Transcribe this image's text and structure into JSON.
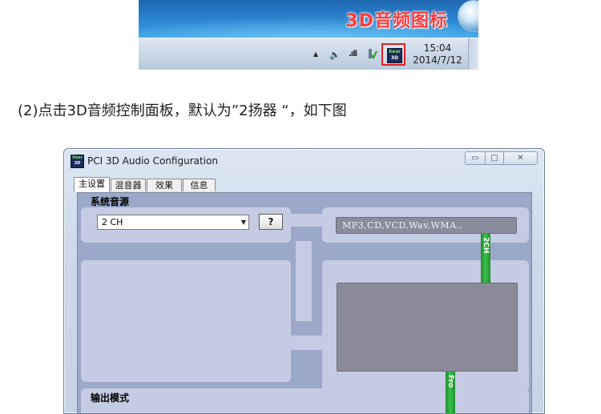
{
  "taskbar": {
    "annotation": "3D音频图标",
    "tray_icon_label_top": "Xear",
    "tray_icon_label_bottom": "3D",
    "time": "15:04",
    "date": "2014/7/12",
    "colors": {
      "annotation": "#ff3a3a",
      "highlight_border": "#e0201c"
    }
  },
  "instruction": "(2)点击3D音频控制面板，默认为”2扬器 “，如下图",
  "window": {
    "title": "PCI 3D Audio Configuration",
    "icon_label_top": "Xear",
    "icon_label_bottom": "3D",
    "controls": {
      "minimize": "▭",
      "maximize": "□",
      "close": "✕"
    },
    "tabs": [
      {
        "label": "主设置",
        "active": true
      },
      {
        "label": "混音器",
        "active": false
      },
      {
        "label": "效果",
        "active": false
      },
      {
        "label": "信息",
        "active": false
      }
    ],
    "main": {
      "system_source_label": "系统音源",
      "channel_select": {
        "value": "2 CH"
      },
      "help_button": "?",
      "format_text": "MP3,CD,VCD,Wav,WMA..",
      "bar_top_label": "2CH",
      "bar_bottom_label": "Fro",
      "output_mode_label": "输出模式"
    }
  }
}
